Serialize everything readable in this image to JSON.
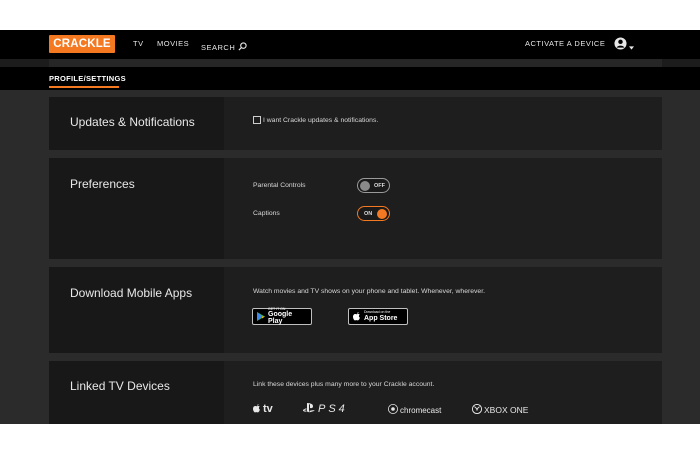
{
  "nav": {
    "logo": "CRACKLE",
    "links": [
      "TV",
      "MOVIES"
    ],
    "search_label": "SEARCH",
    "activate_label": "ACTIVATE A DEVICE"
  },
  "tabs": {
    "active": "PROFILE/SETTINGS"
  },
  "sections": {
    "updates": {
      "title": "Updates & Notifications",
      "checkbox_label": "I want Crackle updates & notifications.",
      "checked": false
    },
    "preferences": {
      "title": "Preferences",
      "parental_label": "Parental Controls",
      "parental_state": "OFF",
      "captions_label": "Captions",
      "captions_state": "ON"
    },
    "apps": {
      "title": "Download Mobile Apps",
      "description": "Watch movies and TV shows on your phone and tablet. Whenever, wherever.",
      "google_small": "GET IT ON",
      "google_big": "Google Play",
      "apple_small": "Download on the",
      "apple_big": "App Store"
    },
    "linked": {
      "title": "Linked TV Devices",
      "description": "Link these devices plus many more to your Crackle account.",
      "devices": [
        "tv",
        "PS4",
        "chromecast",
        "XBOX ONE"
      ]
    }
  },
  "colors": {
    "accent": "#f47921",
    "background": "#2b2b2b",
    "panel": "#1e1e1e"
  },
  "icons": [
    "search-icon",
    "user-icon",
    "caret-down-icon",
    "google-play-icon",
    "apple-icon",
    "chromecast-icon",
    "xbox-icon"
  ]
}
